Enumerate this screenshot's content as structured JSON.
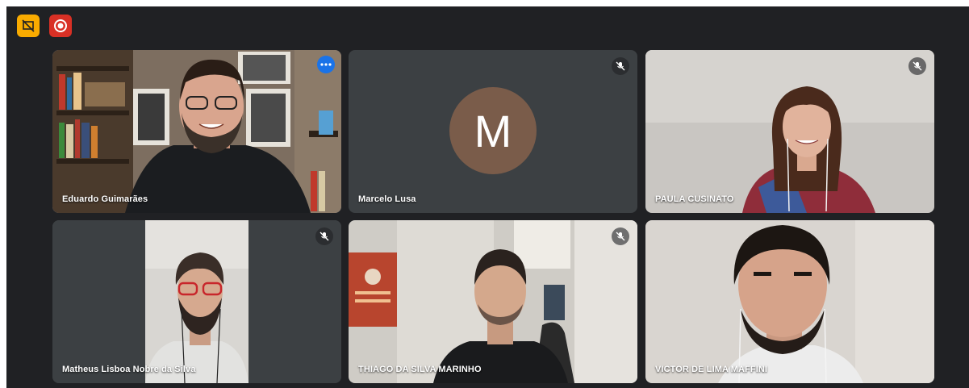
{
  "toolbar": {
    "present_icon": "presentation-off-icon",
    "record_icon": "record-icon",
    "accent_yellow": "#f9ab00",
    "accent_red": "#d93025"
  },
  "participants": [
    {
      "name": "Eduardo Guimarães",
      "muted": false,
      "active_speaker": true
    },
    {
      "name": "Marcelo Lusa",
      "muted": true,
      "avatar_letter": "M"
    },
    {
      "name": "PAULA CUSINATO",
      "muted": true
    },
    {
      "name": "Matheus Lisboa Nobre da Silva",
      "muted": true
    },
    {
      "name": "THIAGO DA SILVA MARINHO",
      "muted": true
    },
    {
      "name": "VICTOR DE LIMA MAFFINI",
      "muted": false
    }
  ],
  "colors": {
    "background": "#202124",
    "tile": "#3c4043",
    "active_border": "#8ab4f8",
    "avatar_bg": "#7a5c4a"
  }
}
